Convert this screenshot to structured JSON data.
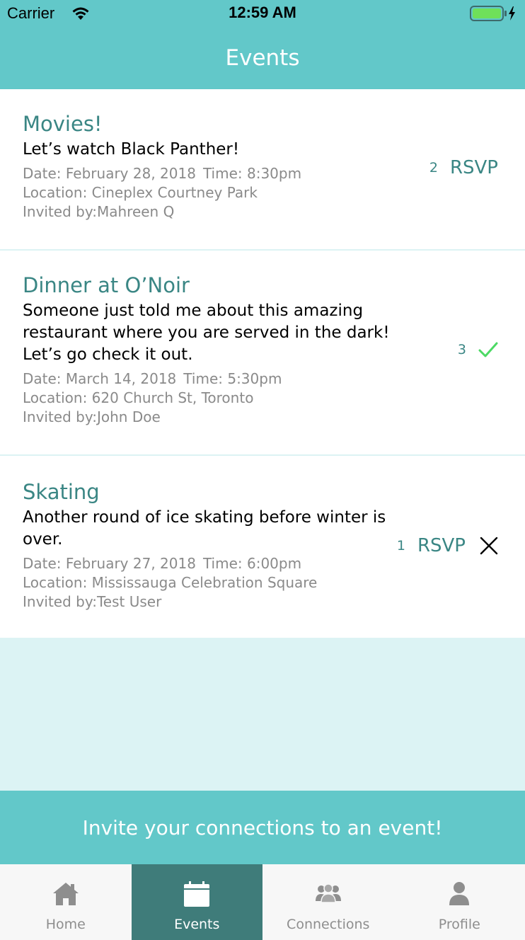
{
  "status_bar": {
    "carrier": "Carrier",
    "time": "12:59 AM"
  },
  "nav": {
    "title": "Events"
  },
  "events": [
    {
      "title": "Movies!",
      "description": "Let’s watch Black Panther!",
      "date": "Date: February 28, 2018",
      "time": "Time: 8:30pm",
      "location": "Location: Cineplex Courtney Park",
      "invited_by": "Invited by:Mahreen Q",
      "count": "2",
      "rsvp_label": "RSVP"
    },
    {
      "title": "Dinner at O’Noir",
      "description": "Someone just told me about this amazing restaurant where you are served in the dark! Let’s go check it out.",
      "date": "Date: March 14, 2018",
      "time": "Time: 5:30pm",
      "location": "Location: 620 Church St, Toronto",
      "invited_by": "Invited by:John Doe",
      "count": "3",
      "status_icon": "check-icon"
    },
    {
      "title": "Skating",
      "description": "Another round of ice skating before winter is over.",
      "date": "Date: February 27, 2018",
      "time": "Time: 6:00pm",
      "location": "Location: Mississauga Celebration Square",
      "invited_by": "Invited by:Test User",
      "count": "1",
      "rsvp_label": "RSVP",
      "status_icon": "close-icon"
    }
  ],
  "invite_banner": {
    "label": "Invite your connections to an event!"
  },
  "tabbar": {
    "tabs": [
      {
        "label": "Home",
        "icon": "home-icon"
      },
      {
        "label": "Events",
        "icon": "calendar-icon",
        "active": true
      },
      {
        "label": "Connections",
        "icon": "connections-icon"
      },
      {
        "label": "Profile",
        "icon": "profile-icon"
      }
    ]
  },
  "colors": {
    "primary": "#62c8c9",
    "accent_text": "#3a8684",
    "active_tab": "#3f7c7a",
    "background": "#dcf3f4",
    "check": "#4cd964"
  }
}
